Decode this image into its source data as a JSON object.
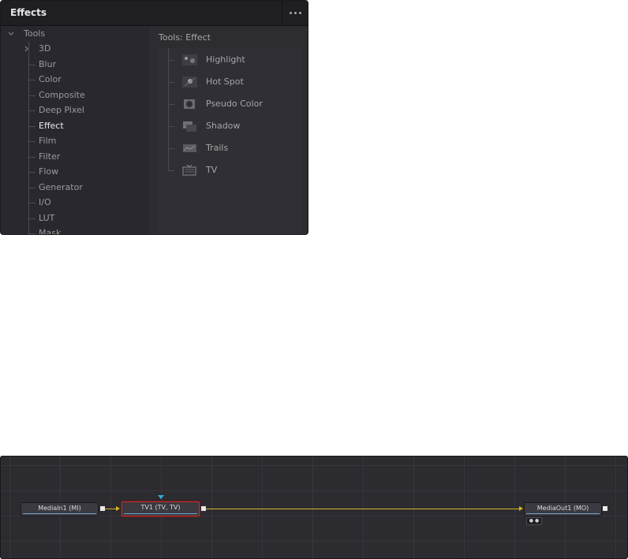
{
  "effects_panel": {
    "title": "Effects",
    "tree": {
      "root_label": "Tools",
      "items": [
        {
          "label": "3D",
          "expandable": true
        },
        {
          "label": "Blur"
        },
        {
          "label": "Color"
        },
        {
          "label": "Composite"
        },
        {
          "label": "Deep Pixel"
        },
        {
          "label": "Effect",
          "selected": true
        },
        {
          "label": "Film"
        },
        {
          "label": "Filter"
        },
        {
          "label": "Flow"
        },
        {
          "label": "Generator"
        },
        {
          "label": "I/O"
        },
        {
          "label": "LUT"
        },
        {
          "label": "Mask"
        }
      ]
    },
    "list": {
      "title": "Tools: Effect",
      "items": [
        {
          "label": "Highlight",
          "icon": "highlight-icon"
        },
        {
          "label": "Hot Spot",
          "icon": "hot-spot-icon"
        },
        {
          "label": "Pseudo Color",
          "icon": "pseudo-color-icon"
        },
        {
          "label": "Shadow",
          "icon": "shadow-icon"
        },
        {
          "label": "Trails",
          "icon": "trails-icon"
        },
        {
          "label": "TV",
          "icon": "tv-icon"
        }
      ]
    }
  },
  "node_graph": {
    "nodes": [
      {
        "label": "MediaIn1  (MI)"
      },
      {
        "label": "TV1  (TV, TV)",
        "selected": true
      },
      {
        "label": "MediaOut1  (MO)"
      }
    ],
    "colors": {
      "link": "#d7b521",
      "selected_border": "#c0302a",
      "view_marker": "#39a6e0"
    }
  }
}
